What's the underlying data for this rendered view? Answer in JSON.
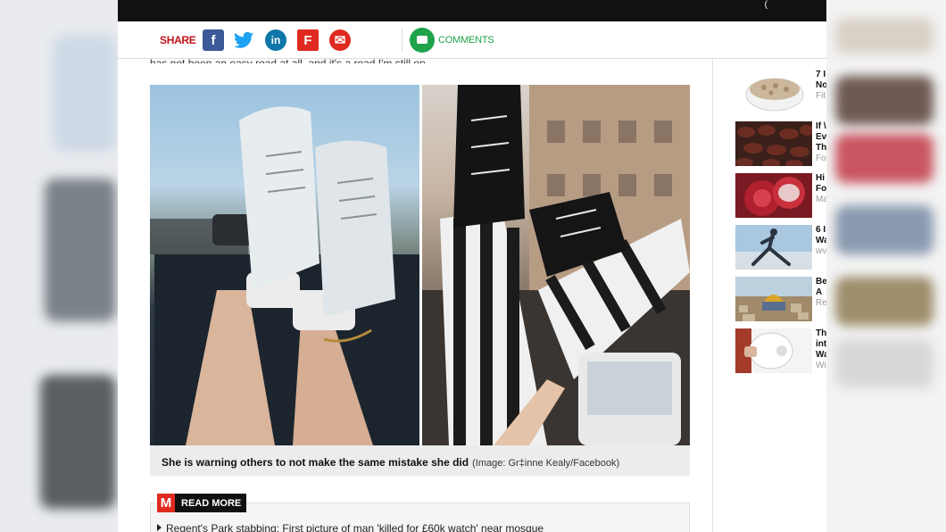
{
  "share": {
    "label": "SHARE",
    "facebook_glyph": "f",
    "twitter_glyph": "🐦",
    "linkedin_glyph": "in",
    "flipboard_glyph": "F",
    "email_glyph": "✉"
  },
  "comments": {
    "label": "COMMENTS"
  },
  "article": {
    "cut_text": "has not been an easy road at all, and it's a road I'm still on."
  },
  "photo": {
    "caption": "She is warning others to not make the same mistake she did",
    "credit": "(Image: Gr‡inne Kealy/Facebook)"
  },
  "read_more": {
    "badge": "M",
    "label": "READ MORE",
    "link": "Regent's Park stabbing: First picture of man 'killed for £60k watch' near mosque"
  },
  "sidebar_ads": [
    {
      "title": "7 I No",
      "source": "Fit",
      "icon": "oatmeal-bowl-icon"
    },
    {
      "title": "If \\ Ev Th",
      "source": "Fo",
      "icon": "dates-fruit-icon"
    },
    {
      "title": "Hi Fo",
      "source": "Ma",
      "icon": "pomegranate-icon"
    },
    {
      "title": "6 I Wa",
      "source": "wv",
      "icon": "yoga-pose-icon"
    },
    {
      "title": "Be A",
      "source": "Re",
      "icon": "jerusalem-city-icon"
    },
    {
      "title": "Th int Wa",
      "source": "Wi",
      "icon": "device-icon"
    }
  ],
  "colors": {
    "brand_red": "#c4151c",
    "facebook": "#3b5998",
    "twitter": "#1da1f2",
    "linkedin": "#0e76a8",
    "comments_green": "#1fa34a"
  }
}
